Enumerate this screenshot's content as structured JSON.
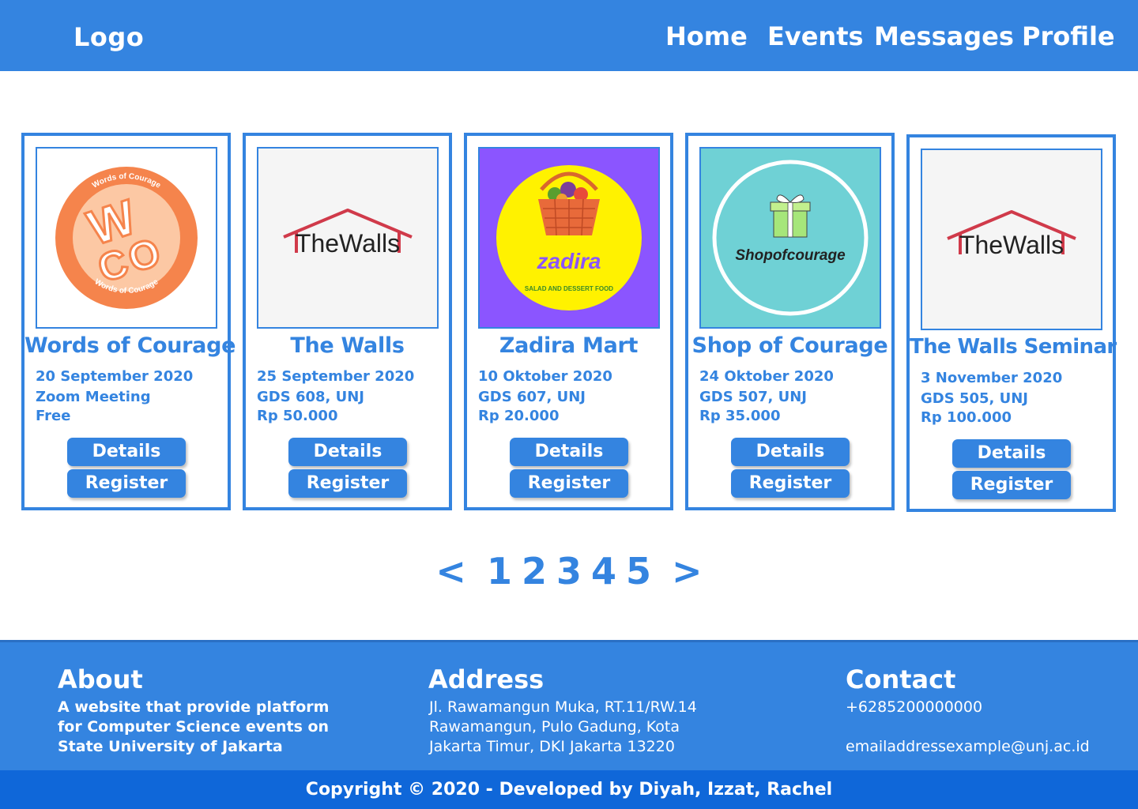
{
  "header": {
    "logo": "Logo",
    "nav": [
      "Home",
      "Events",
      "Messages",
      "Profile"
    ]
  },
  "events": [
    {
      "title": "Words of Courage",
      "date": "20 September 2020",
      "location": "Zoom Meeting",
      "price": "Free",
      "details_label": "Details",
      "register_label": "Register",
      "image": {
        "type": "woc-logo",
        "text_top": "Words of Courage",
        "text_bottom": "Words of Courage",
        "letters": "WCO"
      }
    },
    {
      "title": "The Walls",
      "date": "25 September 2020",
      "location": "GDS 608, UNJ",
      "price": "Rp 50.000",
      "details_label": "Details",
      "register_label": "Register",
      "image": {
        "type": "thewalls-logo",
        "text": "TheWalls"
      }
    },
    {
      "title": "Zadira Mart",
      "date": "10 Oktober 2020",
      "location": "GDS 607, UNJ",
      "price": "Rp 20.000",
      "details_label": "Details",
      "register_label": "Register",
      "image": {
        "type": "zadira-logo",
        "text": "zadira",
        "subtext": "SALAD AND DESSERT FOOD"
      }
    },
    {
      "title": "Shop of Courage",
      "date": "24 Oktober 2020",
      "location": "GDS 507, UNJ",
      "price": "Rp 35.000",
      "details_label": "Details",
      "register_label": "Register",
      "image": {
        "type": "shop-logo",
        "text": "Shopofcourage"
      }
    },
    {
      "title": "The Walls Seminar",
      "date": "3 November 2020",
      "location": "GDS 505, UNJ",
      "price": "Rp 100.000",
      "details_label": "Details",
      "register_label": "Register",
      "image": {
        "type": "thewalls-logo",
        "text": "TheWalls"
      }
    }
  ],
  "pagination": {
    "prev": "<",
    "pages": [
      "1",
      "2",
      "3",
      "4",
      "5"
    ],
    "next": ">"
  },
  "footer": {
    "about": {
      "title": "About",
      "lines": [
        "A website that provide platform",
        "for Computer Science events on",
        "State University of Jakarta"
      ]
    },
    "address": {
      "title": "Address",
      "lines": [
        "Jl. Rawamangun Muka, RT.11/RW.14",
        "Rawamangun, Pulo Gadung, Kota",
        "Jakarta Timur, DKI Jakarta 13220"
      ]
    },
    "contact": {
      "title": "Contact",
      "phone": "+6285200000000",
      "email": "emailaddressexample@unj.ac.id"
    },
    "copyright": "Copyright © 2020 - Developed by Diyah, Izzat, Rachel"
  },
  "colors": {
    "primary": "#3484e0",
    "copyright_bar": "#0f67d9",
    "woc_orange": "#f5844c",
    "woc_peach": "#fcc8a4",
    "walls_red": "#d03a4a",
    "zadira_purple": "#8b55ff",
    "zadira_yellow": "#fff200",
    "shop_teal": "#6fd1d5"
  }
}
